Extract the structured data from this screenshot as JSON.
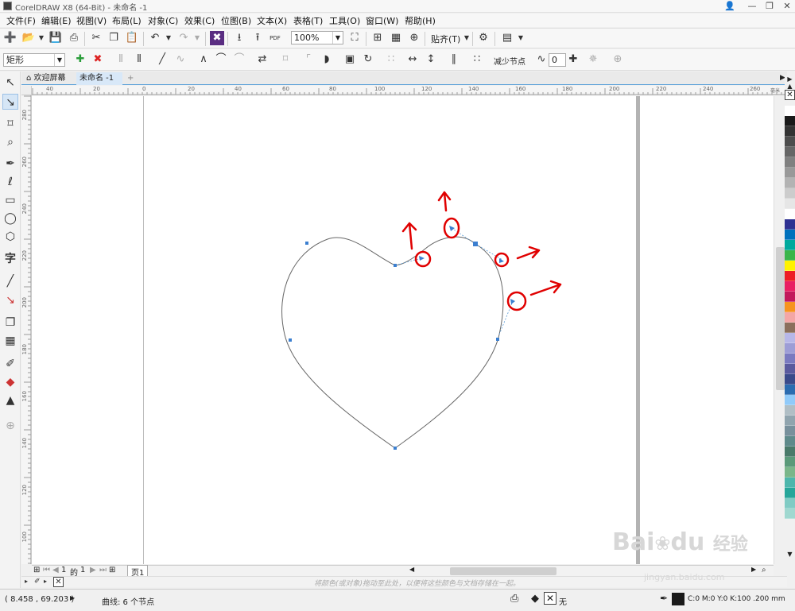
{
  "window": {
    "title": "CorelDRAW X8 (64-Bit) - 未命名 -1",
    "controls": [
      "👤",
      "—",
      "❐",
      "✕"
    ]
  },
  "menu": [
    "文件(F)",
    "编辑(E)",
    "视图(V)",
    "布局(L)",
    "对象(C)",
    "效果(C)",
    "位图(B)",
    "文本(X)",
    "表格(T)",
    "工具(O)",
    "窗口(W)",
    "帮助(H)"
  ],
  "toolbar": {
    "zoom_value": "100%",
    "snap_label": "贴齐(T)",
    "pdf_label": "PDF",
    "icons": [
      "new-icon",
      "open-icon",
      "save-icon",
      "print-icon",
      "import-icon",
      "export-icon",
      "undo-icon",
      "redo-icon",
      "settings-icon"
    ]
  },
  "propbar": {
    "shape_select": "矩形",
    "reduce_nodes_label": "减少节点",
    "smoothness_value": "0"
  },
  "tabs": {
    "welcome": "欢迎屏幕",
    "document": "未命名 -1",
    "add": "+"
  },
  "ruler": {
    "unit": "毫米",
    "h_labels": [
      "40",
      "20",
      "0",
      "20",
      "40",
      "60",
      "80",
      "100",
      "120",
      "140",
      "160",
      "180",
      "200",
      "220",
      "240",
      "260"
    ],
    "v_labels": [
      "280",
      "260",
      "240",
      "220",
      "200",
      "180",
      "160",
      "140",
      "120",
      "100",
      "80"
    ]
  },
  "page_nav": {
    "current": "1",
    "of_label": "的",
    "total": "1",
    "page_tab": "页1"
  },
  "color_hint": "将颜色(或对象)拖动至此处，以便将这些颜色与文档存储在一起。",
  "status": {
    "coords": "( 8.458 , 69.203 )",
    "selection": "曲线: 6 个节点",
    "fill_none": "无",
    "outline": "C:0 M:0 Y:0 K:100  .200 mm"
  },
  "watermark": {
    "brand": "Bai",
    "brand2": "du",
    "cn": "经验",
    "url": "jingyan.baidu.com"
  },
  "colors": {
    "accent": "#4a90d9",
    "annotation": "#e00000",
    "curve": "#555555",
    "node": "#3b7fd0"
  },
  "palette": [
    "#ffffff",
    "#1a1a1a",
    "#333333",
    "#4d4d4d",
    "#666666",
    "#808080",
    "#999999",
    "#b3b3b3",
    "#cccccc",
    "#e6e6e6",
    "#ffffff",
    "#2e3192",
    "#0071bc",
    "#00a99d",
    "#39b54a",
    "#fff200",
    "#ed1c24",
    "#e91e63",
    "#c2185b",
    "#f7931e",
    "#f4a6a6",
    "#8b6f5c",
    "#b7b7e8",
    "#9d9dd6",
    "#7a7ac0",
    "#5a5a9e",
    "#3a4a8a",
    "#2b6cb0",
    "#90caf9",
    "#b0bec5",
    "#90a4ae",
    "#78909c",
    "#5f8a8b",
    "#4a7a6a",
    "#5b9a7a",
    "#7ab68a",
    "#4db6ac",
    "#26a69a",
    "#80cbc4",
    "#a0d8d0"
  ]
}
